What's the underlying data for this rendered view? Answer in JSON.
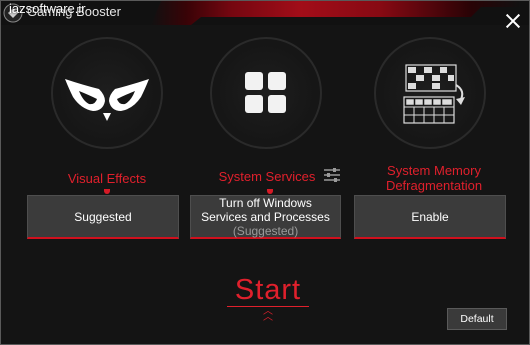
{
  "window": {
    "title": "Gaming Booster",
    "watermark": "iazsoftware.ir"
  },
  "cards": [
    {
      "label_lines": [
        "Visual Effects"
      ],
      "button_text": "Suggested",
      "button_suffix": "",
      "icon": "owl-eyes-icon"
    },
    {
      "label_lines": [
        "System Services"
      ],
      "button_text": "Turn off Windows Services and Processes",
      "button_suffix": "(Suggested)",
      "icon": "grid-icon",
      "settings_icon": "sliders-icon"
    },
    {
      "label_lines": [
        "System Memory",
        "Defragmentation"
      ],
      "button_text": "Enable",
      "button_suffix": "",
      "icon": "memory-defrag-icon"
    }
  ],
  "actions": {
    "start_label": "Start",
    "default_label": "Default"
  },
  "colors": {
    "accent": "#e0202c",
    "background": "#141414",
    "button": "#3b3b3b"
  }
}
